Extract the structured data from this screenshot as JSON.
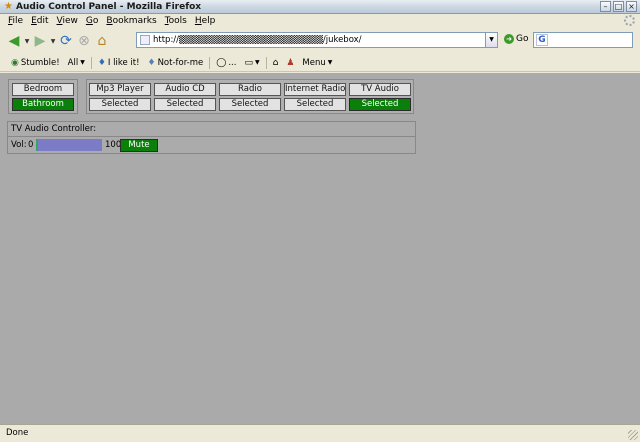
{
  "window": {
    "title": "Audio Control Panel - Mozilla Firefox"
  },
  "menubar": {
    "items": [
      {
        "label_u": "F",
        "label_rest": "ile"
      },
      {
        "label_u": "E",
        "label_rest": "dit"
      },
      {
        "label_u": "V",
        "label_rest": "iew"
      },
      {
        "label_u": "G",
        "label_rest": "o"
      },
      {
        "label_u": "B",
        "label_rest": "ookmarks"
      },
      {
        "label_u": "T",
        "label_rest": "ools"
      },
      {
        "label_u": "H",
        "label_rest": "elp"
      }
    ]
  },
  "navbar": {
    "url": "http://▒▒▒▒▒▒▒▒▒▒▒▒▒▒▒▒▒▒▒▒▒▒/jukebox/",
    "go_label": "Go",
    "search_placeholder": ""
  },
  "stumblebar": {
    "stumble": "Stumble!",
    "all": "All",
    "like": "I like it!",
    "notforme": "Not-for-me",
    "comments": "...",
    "menu": "Menu"
  },
  "rooms": {
    "bedroom": {
      "label": "Bedroom",
      "active": false
    },
    "bathroom": {
      "label": "Bathroom",
      "active": true
    }
  },
  "sources": [
    {
      "name": "Mp3 Player",
      "state": "Selected",
      "active": false
    },
    {
      "name": "Audio CD",
      "state": "Selected",
      "active": false
    },
    {
      "name": "Radio",
      "state": "Selected",
      "active": false
    },
    {
      "name": "Internet Radio",
      "state": "Selected",
      "active": false
    },
    {
      "name": "TV Audio",
      "state": "Selected",
      "active": true
    }
  ],
  "controller": {
    "title": "TV Audio Controller:",
    "vol_label": "Vol:",
    "vol_min": "0",
    "vol_max": "100",
    "mute_label": "Mute"
  },
  "status": {
    "text": "Done"
  },
  "colors": {
    "active_green": "#0a7f0a",
    "content_bg": "#aaaaaa",
    "volume_bar": "#7b7bc6"
  }
}
